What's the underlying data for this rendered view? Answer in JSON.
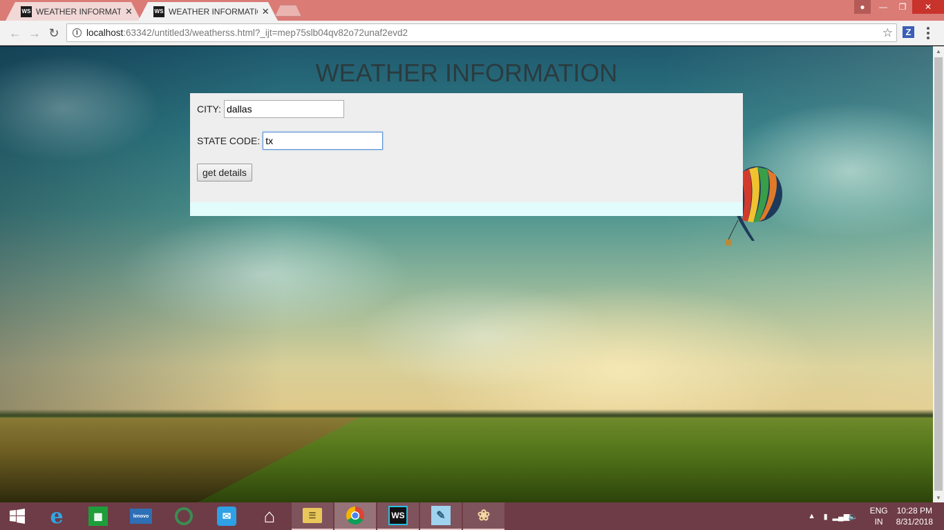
{
  "browser": {
    "tabs": [
      {
        "title": "WEATHER INFORMATION",
        "favicon": "WS",
        "active": false
      },
      {
        "title": "WEATHER INFORMATION",
        "favicon": "WS",
        "active": true
      }
    ],
    "url_host": "localhost",
    "url_rest": ":63342/untitled3/weatherss.html?_ijt=mep75slb04qv82o72unaf2evd2",
    "extension_letter": "Z",
    "icons": {
      "back": "arrow-left-icon",
      "forward": "arrow-right-icon",
      "reload": "reload-icon",
      "info": "info-icon",
      "star": "star-icon",
      "menu": "three-dots-icon"
    }
  },
  "page": {
    "title": "WEATHER INFORMATION",
    "city_label": "CITY:",
    "city_value": "dallas",
    "state_label": "STATE CODE:",
    "state_value": "tx",
    "button_label": "get details",
    "colors": {
      "panel": "#eeeeee",
      "result_strip": "#e2fbfb",
      "title": "#2b3b3f"
    }
  },
  "taskbar": {
    "items": [
      "start",
      "internet-explorer",
      "store",
      "lenovo",
      "cortana-ring",
      "mail",
      "home",
      "file-explorer",
      "chrome",
      "webstorm",
      "notepad",
      "paint"
    ],
    "tray": {
      "lang_top": "ENG",
      "lang_bottom": "IN",
      "time": "10:28 PM",
      "date": "8/31/2018"
    },
    "accent": "#6e3c46"
  }
}
